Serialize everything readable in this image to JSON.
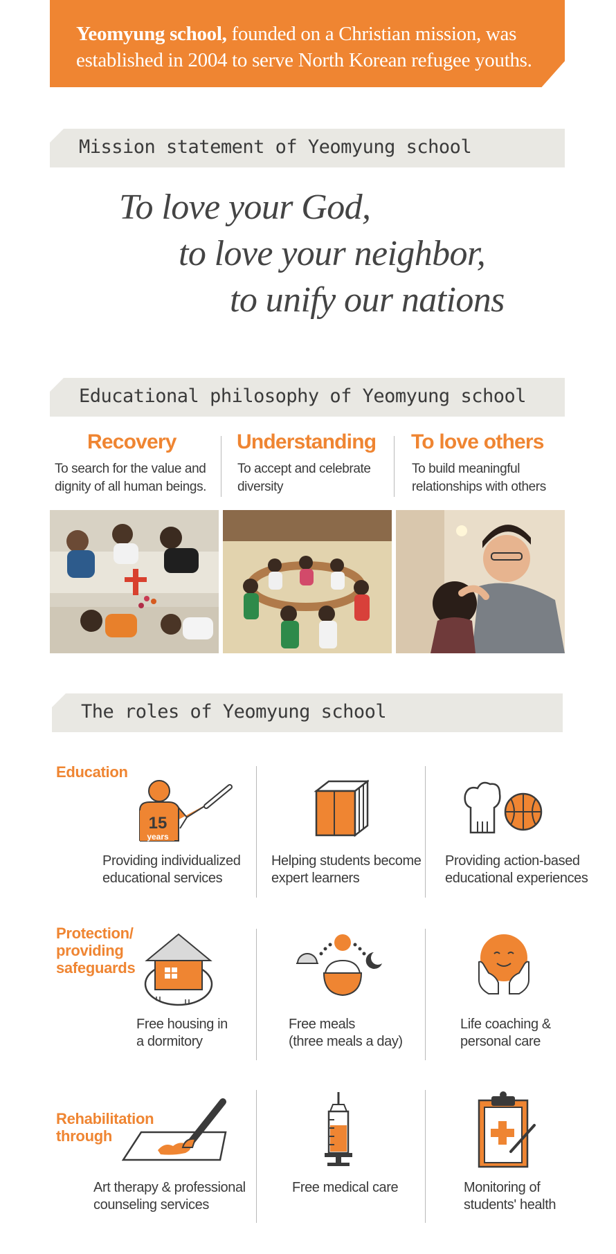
{
  "banner": {
    "bold": "Yeomyung school,",
    "line1_rest": " founded on a Christian mission, was",
    "line2": "established in 2004 to serve North Korean refugee youths."
  },
  "mission": {
    "header": "Mission statement of Yeomyung school",
    "lines": [
      "To love your God,",
      "to love your neighbor,",
      "to unify our nations"
    ]
  },
  "philosophy": {
    "header": "Educational philosophy of Yeomyung school",
    "items": [
      {
        "title": "Recovery",
        "line1": "To search for the value and",
        "line2": "dignity of all human beings."
      },
      {
        "title": "Understanding",
        "line1": "To accept and celebrate",
        "line2": "diversity"
      },
      {
        "title": "To love others",
        "line1": "To build meaningful",
        "line2": "relationships with others"
      }
    ]
  },
  "roles": {
    "header": "The roles of Yeomyung school",
    "education": {
      "category": "Education",
      "badge_number": "15",
      "badge_text": "years",
      "items": [
        {
          "line1": "Providing individualized",
          "line2": "educational services",
          "icon": "teacher-icon"
        },
        {
          "line1": "Helping students become",
          "line2": "expert learners",
          "icon": "books-icon"
        },
        {
          "line1": "Providing action-based",
          "line2": "educational experiences",
          "icon": "chef-basketball-icon"
        }
      ]
    },
    "protection": {
      "category_lines": [
        "Protection/",
        "providing",
        "safeguards"
      ],
      "items": [
        {
          "line1": "Free housing in",
          "line2": "a dormitory",
          "icon": "house-icon"
        },
        {
          "line1": "Free meals",
          "line2": "(three meals a day)",
          "icon": "meal-icon"
        },
        {
          "line1": "Life coaching &",
          "line2": "personal care",
          "icon": "caring-hands-icon"
        }
      ]
    },
    "rehabilitation": {
      "category_lines": [
        "Rehabilitation",
        "through"
      ],
      "items": [
        {
          "line1": "Art therapy & professional",
          "line2": "counseling services",
          "icon": "paintbrush-icon"
        },
        {
          "line1": "Free medical care",
          "line2": "",
          "icon": "syringe-icon"
        },
        {
          "line1": "Monitoring of",
          "line2": "students' health",
          "icon": "clipboard-icon"
        }
      ]
    }
  },
  "colors": {
    "accent": "#ef8532",
    "bar": "#e9e8e3",
    "text": "#3a3a3a"
  }
}
